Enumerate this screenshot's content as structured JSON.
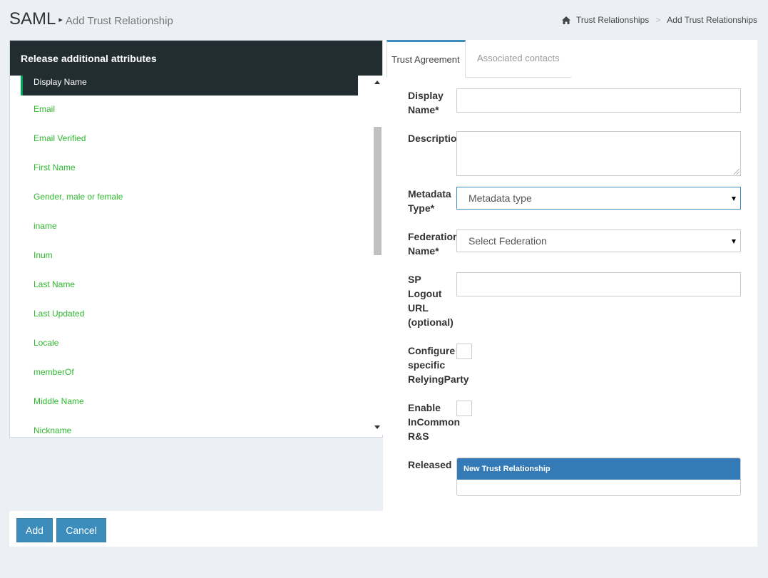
{
  "header": {
    "title": "SAML",
    "subtitle": "Add Trust Relationship",
    "breadcrumb": [
      "Trust Relationships",
      "Add Trust Relationships"
    ]
  },
  "left_panel": {
    "title": "Release additional attributes",
    "items": [
      "Display Name",
      "Email",
      "Email Verified",
      "First Name",
      "Gender, male or female",
      "iname",
      "Inum",
      "Last Name",
      "Last Updated",
      "Locale",
      "memberOf",
      "Middle Name",
      "Nickname"
    ]
  },
  "tabs": [
    "Trust Agreement",
    "Associated contacts"
  ],
  "form": {
    "display_name_label": "Display\nName*",
    "description_label": "Description",
    "metadata_type_label": "Metadata\nType*",
    "metadata_type_value": "Metadata type",
    "federation_name_label": "Federation\nName*",
    "federation_name_value": "Select Federation",
    "sp_logout_label": "SP\nLogout\nURL\n(optional)",
    "configure_label": "Configure\nspecific\nRelyingParty",
    "incommon_label": "Enable\nInCommon\nR&S",
    "released_label": "Released",
    "released_box_title": "New Trust Relationship"
  },
  "footer": {
    "add_label": "Add",
    "cancel_label": "Cancel"
  },
  "colors": {
    "accent": "#3c8dbc",
    "dark": "#222d32",
    "link_green": "#2eb82e"
  }
}
